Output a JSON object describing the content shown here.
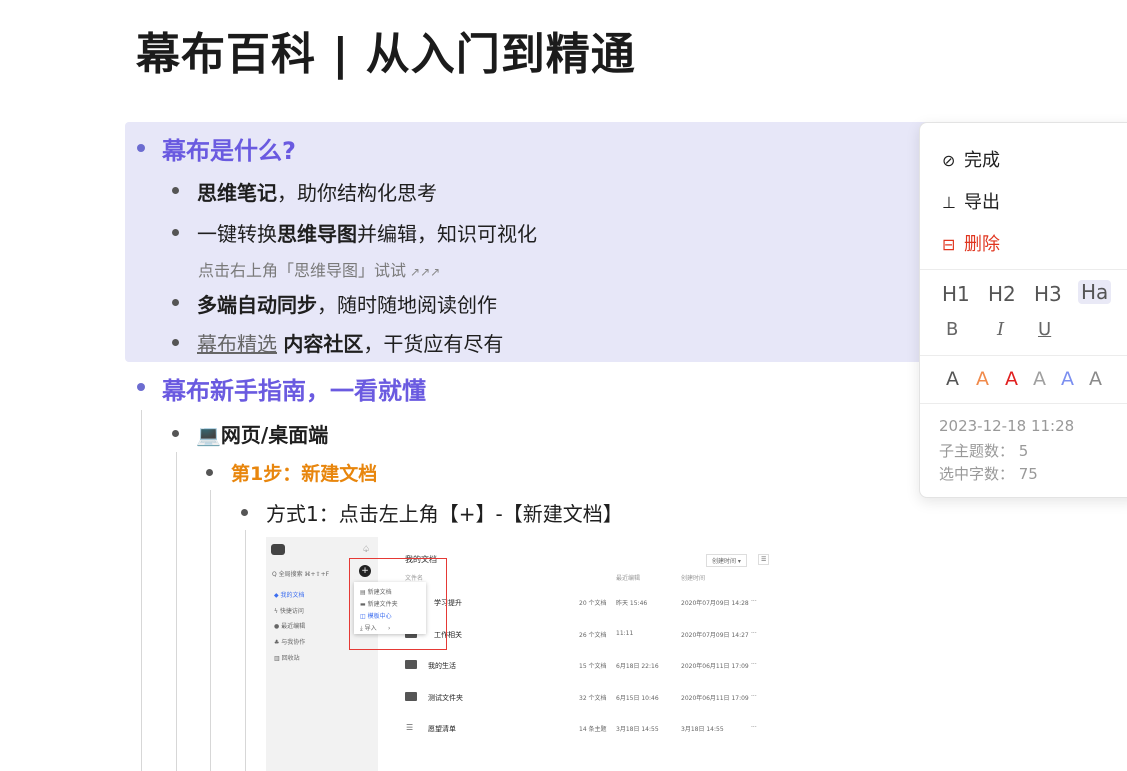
{
  "doc": {
    "title": "幕布百科 | 从入门到精通",
    "topic1": "幕布是什么?",
    "t1_item1_bold": "思维笔记",
    "t1_item1_rest": "，助你结构化思考",
    "t1_item2_a": "一键转换",
    "t1_item2_bold": "思维导图",
    "t1_item2_c": "并编辑，知识可视化",
    "t1_note": "点击右上角「思维导图」试试",
    "t1_note_arrows": "↗↗↗",
    "t1_item3_bold": "多端自动同步",
    "t1_item3_rest": "，随时随地阅读创作",
    "t1_item4_link": "幕布精选",
    "t1_item4_bold": "内容社区",
    "t1_item4_rest": "，干货应有尽有",
    "topic2": "幕布新手指南，一看就懂",
    "web_icon": "💻",
    "web_label": "网页/桌面端",
    "step1": "第1步：新建文档",
    "method1": "方式1：点击左上角【+】-【新建文档】"
  },
  "shot": {
    "search_placeholder": "Q 全局搜索 ⌘+⇧+F",
    "side_items": [
      "我的文档",
      "快捷访问",
      "最近编辑",
      "与我协作",
      "回收站"
    ],
    "header_title": "我的文档",
    "sort_button": "创建时间 ▾",
    "col_name": "文件名",
    "col_edit": "最近编辑",
    "col_created": "创建时间",
    "menu_items": [
      "新建文档",
      "新建文件夹",
      "模板中心",
      "导入"
    ],
    "rows": [
      {
        "name": "学习提升",
        "count": "20 个文档",
        "edit": "昨天 15:46",
        "created": "2020年07月09日 14:28"
      },
      {
        "name": "工作相关",
        "count": "26 个文档",
        "edit": "11:11",
        "created": "2020年07月09日 14:27"
      },
      {
        "name": "我的生活",
        "count": "15 个文档",
        "edit": "6月18日 22:16",
        "created": "2020年06月11日 17:09"
      },
      {
        "name": "测试文件夹",
        "count": "32 个文档",
        "edit": "6月15日 10:46",
        "created": "2020年06月11日 17:09"
      },
      {
        "name": "愿望清单",
        "count": "14 条主题",
        "edit": "3月18日 14:55",
        "created": "3月18日 14:55"
      }
    ]
  },
  "panel": {
    "done": "完成",
    "export": "导出",
    "delete": "删除",
    "headings": [
      "H1",
      "H2",
      "H3",
      "Ha"
    ],
    "bold": "B",
    "italic": "I",
    "underline": "U",
    "color_letter": "A",
    "colors": [
      "#555555",
      "#f08a4b",
      "#e02020",
      "#a0a0a0",
      "#7b8ff0",
      "#8a8a8a"
    ],
    "timestamp": "2023-12-18 11:28",
    "subtopics": "子主题数：  5",
    "selected_chars": "选中字数：  75"
  }
}
